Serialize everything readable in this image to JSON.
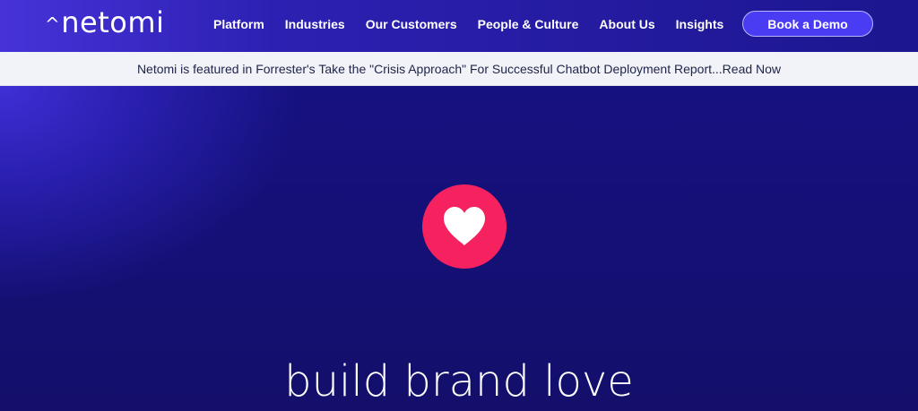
{
  "header": {
    "logo_text": "netomi",
    "logo_caret": "^",
    "nav": [
      {
        "label": "Platform"
      },
      {
        "label": "Industries"
      },
      {
        "label": "Our Customers"
      },
      {
        "label": "People & Culture"
      },
      {
        "label": "About Us"
      },
      {
        "label": "Insights"
      }
    ],
    "cta_label": "Book a Demo"
  },
  "announcement": {
    "text": "Netomi is featured in Forrester's Take the \"Crisis Approach\" For Successful Chatbot Deployment Report...Read Now"
  },
  "hero": {
    "icon": "heart-icon",
    "heading": "build brand love"
  },
  "colors": {
    "nav_gradient_start": "#4633d8",
    "hero_background": "#130f6a",
    "accent_pink": "#f5225f",
    "button_purple": "#4a3cf2",
    "announcement_bg": "#f2f3f8"
  }
}
